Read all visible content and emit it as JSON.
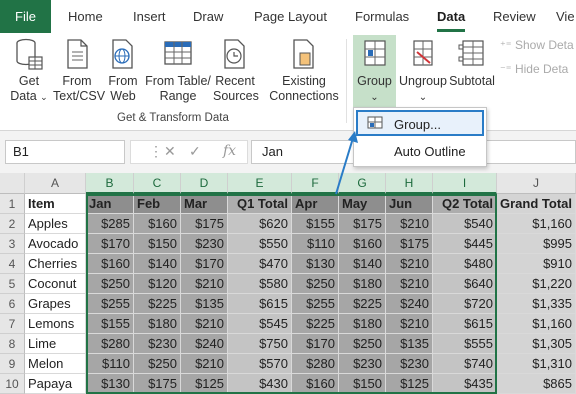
{
  "tabs": [
    "File",
    "Home",
    "Insert",
    "Draw",
    "Page Layout",
    "Formulas",
    "Data",
    "Review",
    "Vie"
  ],
  "active_tab": "Data",
  "ribbon": {
    "get_data": {
      "line1": "Get",
      "line2": "Data"
    },
    "from_text": {
      "line1": "From",
      "line2": "Text/CSV"
    },
    "from_web": {
      "line1": "From",
      "line2": "Web"
    },
    "from_table": {
      "line1": "From Table/",
      "line2": "Range"
    },
    "recent_sources": {
      "line1": "Recent",
      "line2": "Sources"
    },
    "existing_connections": {
      "line1": "Existing",
      "line2": "Connections"
    },
    "group_label": "Get & Transform Data",
    "group": "Group",
    "ungroup": "Ungroup",
    "subtotal": "Subtotal",
    "show_detail": "Show Deta",
    "hide_detail": "Hide Deta"
  },
  "menu": {
    "group_item": "Group...",
    "auto_outline": "Auto Outline"
  },
  "formula_bar": {
    "name_box": "B1",
    "fx": "fx",
    "value": "Jan"
  },
  "colors": {
    "accent": "#217346",
    "selected_header": "#d3e9da",
    "highlight_blue": "#2a7cc7"
  },
  "columns": [
    "A",
    "B",
    "C",
    "D",
    "E",
    "F",
    "G",
    "H",
    "I",
    "J"
  ],
  "rows": [
    [
      "Item",
      "Jan",
      "Feb",
      "Mar",
      "Q1 Total",
      "Apr",
      "May",
      "Jun",
      "Q2 Total",
      "Grand Total"
    ],
    [
      "Apples",
      "$285",
      "$160",
      "$175",
      "$620",
      "$155",
      "$175",
      "$210",
      "$540",
      "$1,160"
    ],
    [
      "Avocado",
      "$170",
      "$150",
      "$230",
      "$550",
      "$110",
      "$160",
      "$175",
      "$445",
      "$995"
    ],
    [
      "Cherries",
      "$160",
      "$140",
      "$170",
      "$470",
      "$130",
      "$140",
      "$210",
      "$480",
      "$910"
    ],
    [
      "Coconut",
      "$250",
      "$120",
      "$210",
      "$580",
      "$250",
      "$180",
      "$210",
      "$640",
      "$1,220"
    ],
    [
      "Grapes",
      "$255",
      "$225",
      "$135",
      "$615",
      "$255",
      "$225",
      "$240",
      "$720",
      "$1,335"
    ],
    [
      "Lemons",
      "$155",
      "$180",
      "$210",
      "$545",
      "$225",
      "$180",
      "$210",
      "$615",
      "$1,160"
    ],
    [
      "Lime",
      "$280",
      "$230",
      "$240",
      "$750",
      "$170",
      "$250",
      "$135",
      "$555",
      "$1,305"
    ],
    [
      "Melon",
      "$110",
      "$250",
      "$210",
      "$570",
      "$280",
      "$230",
      "$230",
      "$740",
      "$1,310"
    ],
    [
      "Papaya",
      "$130",
      "$175",
      "$125",
      "$430",
      "$160",
      "$150",
      "$125",
      "$435",
      "$865"
    ]
  ]
}
